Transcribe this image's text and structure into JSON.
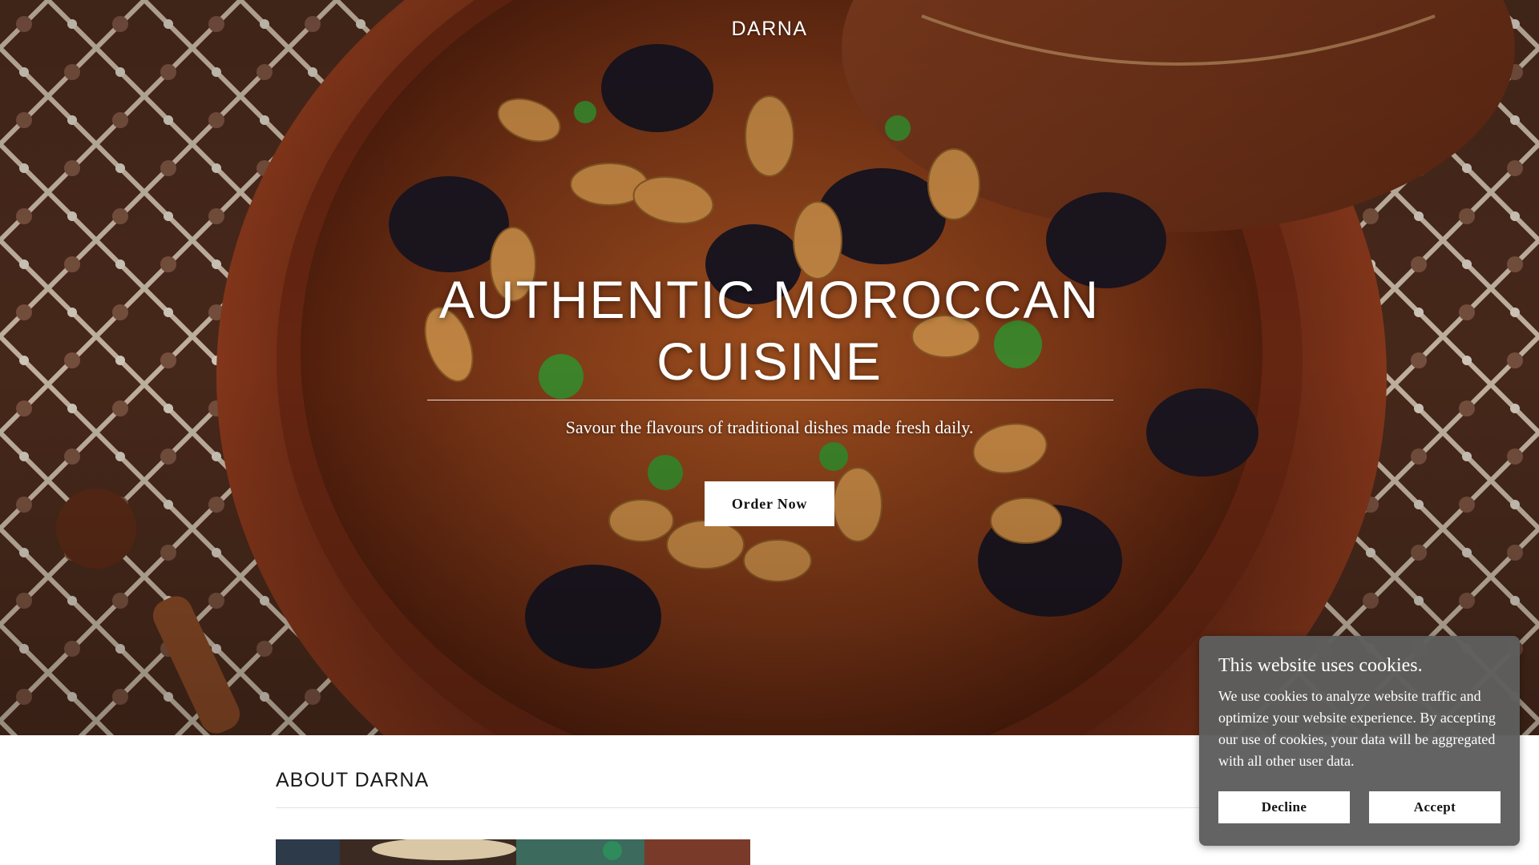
{
  "header": {
    "brand": "DARNA"
  },
  "hero": {
    "title": "AUTHENTIC MOROCCAN CUISINE",
    "tagline": "Savour the flavours of traditional dishes made fresh daily.",
    "cta_label": "Order Now",
    "image_icon": "tagine-photo"
  },
  "about": {
    "heading": "ABOUT DARNA",
    "image_icon": "restaurant-photo"
  },
  "cookie_banner": {
    "title": "This website uses cookies.",
    "body": "We use cookies to analyze website traffic and optimize your website experience. By accepting our use of cookies, your data will be aggregated with all other user data.",
    "decline_label": "Decline",
    "accept_label": "Accept"
  },
  "colors": {
    "hero_overlay": "#3a1a0e",
    "tagine_clay": "#8a3a1e",
    "cookie_bg": "#5e5e5e",
    "button_bg": "#ffffff",
    "text_dark": "#1b1b1b"
  }
}
